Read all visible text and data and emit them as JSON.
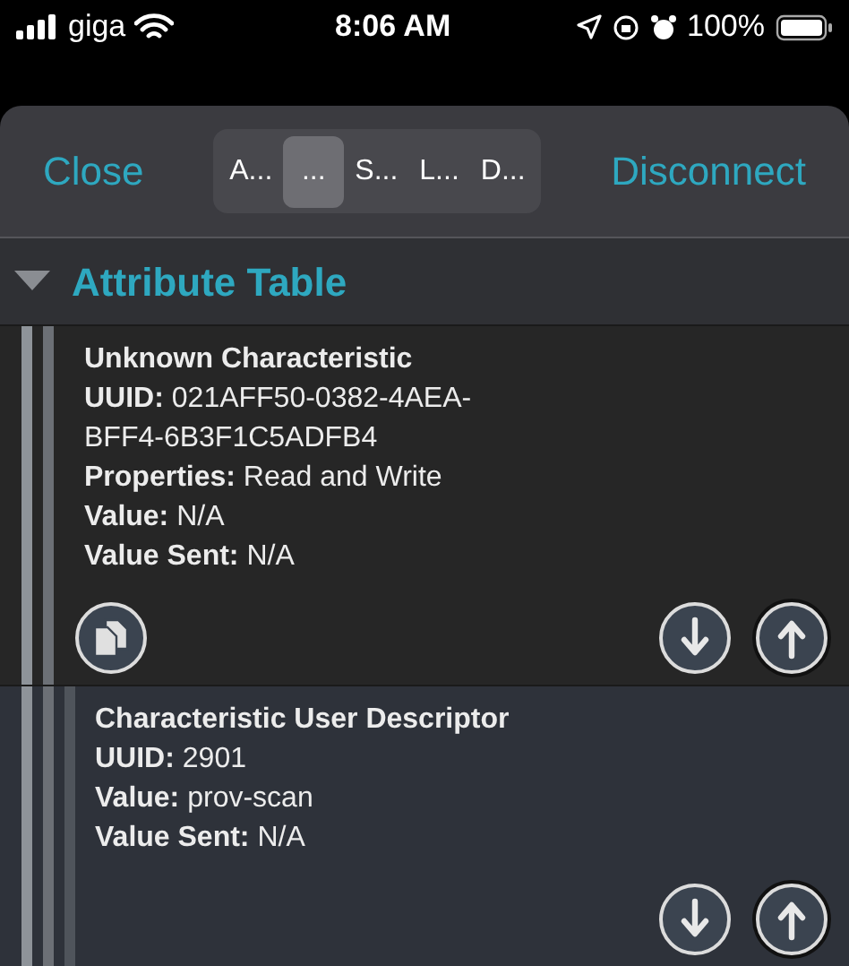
{
  "status_bar": {
    "carrier": "giga",
    "time": "8:06 AM",
    "battery": "100%"
  },
  "header": {
    "close": "Close",
    "disconnect": "Disconnect",
    "segments": [
      {
        "label": "A...",
        "selected": false
      },
      {
        "label": "...",
        "selected": true
      },
      {
        "label": "S...",
        "selected": false
      },
      {
        "label": "L...",
        "selected": false
      },
      {
        "label": "D...",
        "selected": false
      }
    ]
  },
  "section": {
    "title": "Attribute Table",
    "expanded": true
  },
  "attributes": [
    {
      "title": "Unknown Characteristic",
      "fields": [
        {
          "label": "UUID:",
          "value": "021AFF50-0382-4AEA-BFF4-6B3F1C5ADFB4"
        },
        {
          "label": "Properties:",
          "value": "Read and Write"
        },
        {
          "label": "Value:",
          "value": "N/A"
        },
        {
          "label": "Value Sent:",
          "value": "N/A"
        }
      ],
      "actions": [
        {
          "kind": "copy"
        },
        {
          "kind": "read"
        },
        {
          "kind": "write"
        }
      ],
      "children": [
        {
          "title": "Characteristic User Descriptor",
          "fields": [
            {
              "label": "UUID:",
              "value": "2901"
            },
            {
              "label": "Value:",
              "value": "prov-scan"
            },
            {
              "label": "Value Sent:",
              "value": "N/A"
            }
          ],
          "actions": [
            {
              "kind": "read"
            },
            {
              "kind": "write"
            }
          ]
        }
      ]
    }
  ]
}
